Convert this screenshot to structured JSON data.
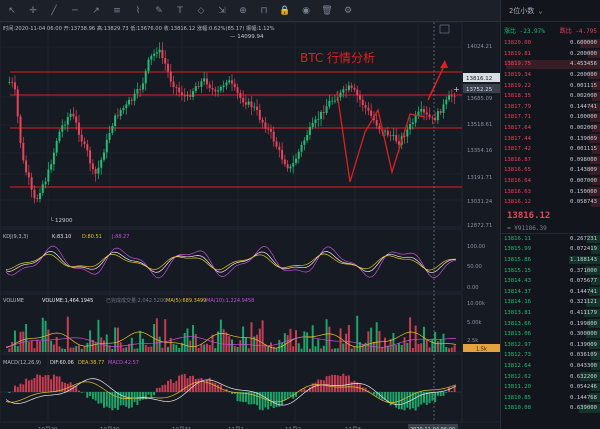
{
  "colors": {
    "up": "#1fbf75",
    "down": "#e8445a",
    "bg": "#161a23",
    "grid": "#252a35",
    "panel": "#12151c",
    "annot": "#e02020"
  },
  "toolbar": {
    "icons": [
      "cursor-icon",
      "crosshair-icon",
      "trendline-icon",
      "horizontal-line-icon",
      "ray-icon",
      "channel-icon",
      "fibonacci-icon",
      "brush-icon",
      "text-icon",
      "pattern-icon",
      "measure-icon",
      "zoom-icon",
      "magnet-icon",
      "lock-icon",
      "eye-icon",
      "trash-icon",
      "settings-icon"
    ]
  },
  "main": {
    "info": {
      "time_label": "时间",
      "time": "2020-11-04 06:00",
      "open_label": "开",
      "open": "13738.96",
      "high_label": "高",
      "high": "13829.73",
      "low_label": "低",
      "low": "13676.00",
      "close_label": "收",
      "close": "13816.12",
      "change_label": "涨幅",
      "change": "0.62%(85.17)",
      "amp_label": "振幅",
      "amp": "1.12%"
    },
    "annotation": "BTC  行情分析",
    "high_marker": "14099.94",
    "low_marker": "12900",
    "y_ticks": [
      "14024.21",
      "13685.09",
      "13518.61",
      "13354.16",
      "13191.71",
      "13031.24",
      "12872.71"
    ],
    "price_tags": {
      "current": "13816.12",
      "crosshair": "13752.25"
    },
    "x_ticks": [
      "10月29",
      "10月30",
      "10月31",
      "11月1",
      "11月2",
      "11月3",
      "2020-11-04 06:00"
    ]
  },
  "kdj": {
    "label": "KDJ(9,3,3)",
    "k": "K:83.10",
    "d": "D:80.51",
    "j": "J:88.27",
    "ticks": [
      "100.00",
      "50.00",
      "0.00"
    ]
  },
  "volume": {
    "label": "VOLUME",
    "vol": "VOLUME:1,464.1945",
    "closed": "已完成成交量:2,042.5200",
    "ma5": "MA(5):689.3499",
    "ma10": "MA(10):1,224.9458",
    "ticks": [
      "10.00k",
      "5.00k",
      "2.5k",
      "1.5k"
    ]
  },
  "macd": {
    "label": "MACD(12,26,9)",
    "dif": "DIF:60.06",
    "dea": "DEA:38.77",
    "macd": "MACD:42.57"
  },
  "sidebar": {
    "depth_label": "2位小数 ⌄",
    "pct_up": "涨比 -23.97%",
    "pct_down": "跌比 -4.795",
    "asks": [
      [
        "13820.00",
        "0.600000"
      ],
      [
        "13819.81",
        "0.200000"
      ],
      [
        "13819.75",
        "4.453456"
      ],
      [
        "13819.34",
        "0.200000"
      ],
      [
        "13819.22",
        "0.001115"
      ],
      [
        "13818.35",
        "0.002000"
      ],
      [
        "13817.79",
        "0.144741"
      ],
      [
        "13817.71",
        "0.100000"
      ],
      [
        "13817.64",
        "0.002000"
      ],
      [
        "13817.44",
        "0.139009"
      ],
      [
        "13817.42",
        "0.001115"
      ],
      [
        "13816.87",
        "0.098000"
      ],
      [
        "13816.65",
        "0.143809"
      ],
      [
        "13816.64",
        "0.007000"
      ],
      [
        "13816.63",
        "0.150000"
      ],
      [
        "13816.12",
        "0.058743"
      ]
    ],
    "last_price": "13816.12",
    "last_sub": "≈ ¥91186.39",
    "bids": [
      [
        "13816.11",
        "0.267231"
      ],
      [
        "13815.99",
        "0.072419"
      ],
      [
        "13815.86",
        "1.188143"
      ],
      [
        "13815.15",
        "0.371000"
      ],
      [
        "13814.43",
        "0.075677"
      ],
      [
        "13814.37",
        "0.144741"
      ],
      [
        "13814.16",
        "0.321121"
      ],
      [
        "13813.81",
        "0.411179"
      ],
      [
        "13813.66",
        "0.199800"
      ],
      [
        "13813.06",
        "0.300000"
      ],
      [
        "13812.97",
        "0.139009"
      ],
      [
        "13812.73",
        "0.036109"
      ],
      [
        "13812.64",
        "0.043300"
      ],
      [
        "13812.62",
        "0.632200"
      ],
      [
        "13811.20",
        "0.054246"
      ],
      [
        "13810.85",
        "0.144768"
      ],
      [
        "13810.08",
        "0.639000"
      ]
    ]
  }
}
